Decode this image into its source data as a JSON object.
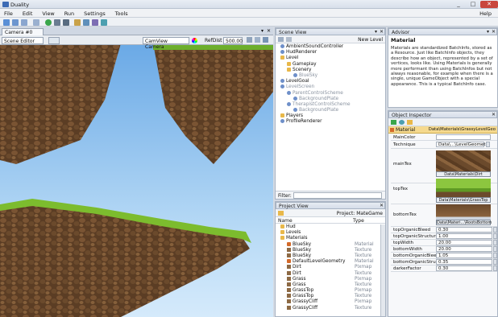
{
  "app": {
    "title": "Duality",
    "minimize": "_",
    "maximize": "□",
    "close": "✕"
  },
  "menu": [
    "File",
    "Edit",
    "View",
    "Run",
    "Settings",
    "Tools",
    "Help"
  ],
  "camera_view": {
    "tab": "Camera #0",
    "mode": "Scene Editor",
    "camera": "CamView Camera",
    "ref_label": "RefDist",
    "ref_value": "500.00"
  },
  "scene_view": {
    "title": "Scene View",
    "new_level": "New Level",
    "filter_label": "Filter:",
    "items": [
      {
        "label": "AmbientSoundController",
        "icon": "obj",
        "indent": 0,
        "dim": false
      },
      {
        "label": "HudRenderer",
        "icon": "obj",
        "indent": 0,
        "dim": false
      },
      {
        "label": "Level",
        "icon": "fold",
        "indent": 0,
        "dim": false
      },
      {
        "label": "Gameplay",
        "icon": "fold",
        "indent": 1,
        "dim": false
      },
      {
        "label": "Scenery",
        "icon": "fold",
        "indent": 1,
        "dim": false
      },
      {
        "label": "BlueSky",
        "icon": "obj",
        "indent": 2,
        "dim": true
      },
      {
        "label": "LevelGoal",
        "icon": "obj",
        "indent": 0,
        "dim": false
      },
      {
        "label": "LevelScreen",
        "icon": "obj",
        "indent": 0,
        "dim": true
      },
      {
        "label": "ParentControlScheme",
        "icon": "obj",
        "indent": 1,
        "dim": true
      },
      {
        "label": "BackgroundPlate",
        "icon": "obj",
        "indent": 2,
        "dim": true
      },
      {
        "label": "TherapistControlScheme",
        "icon": "obj",
        "indent": 1,
        "dim": true
      },
      {
        "label": "BackgroundPlate",
        "icon": "obj",
        "indent": 2,
        "dim": true
      },
      {
        "label": "Players",
        "icon": "fold",
        "indent": 0,
        "dim": false
      },
      {
        "label": "ProfileRenderer",
        "icon": "obj",
        "indent": 0,
        "dim": false
      }
    ]
  },
  "project_view": {
    "title": "Project View",
    "project": "Project: MateGame",
    "col_name": "Name",
    "col_type": "Type",
    "items": [
      {
        "label": "Hud",
        "type": "",
        "icon": "fold",
        "indent": 0
      },
      {
        "label": "Levels",
        "type": "",
        "icon": "fold",
        "indent": 0
      },
      {
        "label": "Materials",
        "type": "",
        "icon": "fold",
        "indent": 0
      },
      {
        "label": "BlueSky",
        "type": "Material",
        "icon": "mat",
        "indent": 1
      },
      {
        "label": "BlueSky",
        "type": "Texture",
        "icon": "tex",
        "indent": 1
      },
      {
        "label": "BlueSky",
        "type": "Texture",
        "icon": "tex",
        "indent": 1
      },
      {
        "label": "DefaultLevelGeometry",
        "type": "Material",
        "icon": "mat",
        "indent": 1
      },
      {
        "label": "Dirt",
        "type": "Pixmap",
        "icon": "tex",
        "indent": 1
      },
      {
        "label": "Dirt",
        "type": "Texture",
        "icon": "tex",
        "indent": 1
      },
      {
        "label": "Grass",
        "type": "Pixmap",
        "icon": "tex",
        "indent": 1
      },
      {
        "label": "Grass",
        "type": "Texture",
        "icon": "tex",
        "indent": 1
      },
      {
        "label": "GrassTop",
        "type": "Pixmap",
        "icon": "tex",
        "indent": 1
      },
      {
        "label": "GrassTop",
        "type": "Texture",
        "icon": "tex",
        "indent": 1
      },
      {
        "label": "GrassyCliff",
        "type": "Pixmap",
        "icon": "tex",
        "indent": 1
      },
      {
        "label": "GrassyCliff",
        "type": "Texture",
        "icon": "tex",
        "indent": 1
      }
    ]
  },
  "advisor": {
    "title": "Advisor",
    "heading": "Material",
    "body": "Materials are standardized BatchInfo, stored as a Resource. Just like BatchInfo objects, they describe how an object, represented by a set of vertices, looks like. Using Materials is generally more performant than using BatchInfos but not always reasonable, for example when there is a single, unique GameObject with a special appearance. This is a typical BatchInfo case."
  },
  "inspector": {
    "title": "Object Inspector",
    "header_left": "Material",
    "header_right": "Data\\Materials\\GrassyLevelGeo",
    "main_color_label": "MainColor",
    "technique_label": "Technique",
    "technique_value": "Data\\...\\LevelGeometry",
    "maintex_label": "mainTex",
    "maintex_value": "Data\\Materials\\Dirt",
    "toptex_label": "topTex",
    "toptex_value": "Data\\Materials\\GrassTop",
    "bottomtex_label": "bottomTex",
    "bottomtex_value": "Data\\Materi...\\RootsBottom",
    "props": [
      {
        "label": "topOrganicBleed",
        "value": "0.30"
      },
      {
        "label": "topOrganicStructure",
        "value": "1.00"
      },
      {
        "label": "topWidth",
        "value": "20.00"
      },
      {
        "label": "bottomWidth",
        "value": "20.00"
      },
      {
        "label": "bottomOrganicBleed",
        "value": "1.05"
      },
      {
        "label": "bottomOrganicStruc",
        "value": "0.35"
      },
      {
        "label": "darkerFactor",
        "value": "0.30"
      }
    ]
  }
}
